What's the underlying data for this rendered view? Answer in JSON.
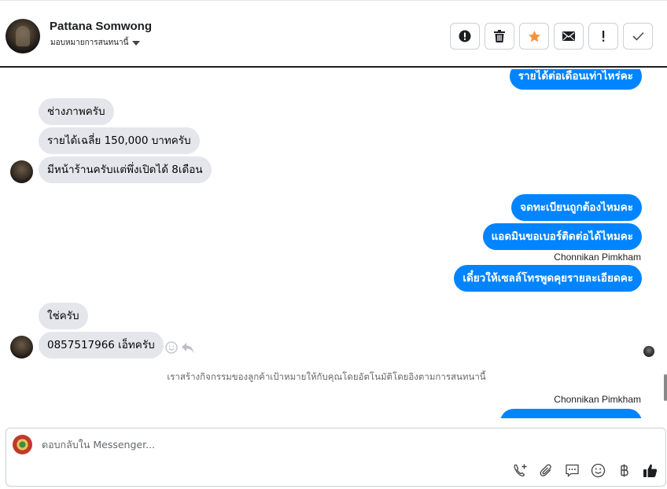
{
  "header": {
    "contact_name": "Pattana Somwong",
    "assign_label": "มอบหมายการสนทนานี้"
  },
  "actions": [
    {
      "name": "report-spam-button",
      "icon": "alert-circle-icon"
    },
    {
      "name": "delete-button",
      "icon": "trash-icon"
    },
    {
      "name": "star-button",
      "icon": "star-icon",
      "color": "#f7923b"
    },
    {
      "name": "mark-unread-button",
      "icon": "envelope-icon"
    },
    {
      "name": "follow-up-button",
      "icon": "exclamation-icon"
    },
    {
      "name": "mark-done-button",
      "icon": "check-icon"
    }
  ],
  "messages": {
    "out_1": "รายได้ต่อเดือนเท่าไหร่คะ",
    "in_1": "ช่างภาพครับ",
    "in_2": "รายได้เฉลี่ย 150,000 บาทครับ",
    "in_3": "มีหน้าร้านครับแต่พึ่งเปิดได้ 8เดือน",
    "out_2": "จดทะเบียนถูกต้องไหมคะ",
    "out_3": "แอดมินขอเบอร์ติดต่อได้ไหมคะ",
    "sender_1": "Chonnikan Pimkham",
    "out_4": "เดี๋ยวให้เซลล์โทรพูดคุยรายละเอียดคะ",
    "in_4": "ใช่ครับ",
    "in_5": "0857517966 เอ็ทครับ",
    "system_note": "เราสร้างกิจกรรมของลูกค้าเป้าหมายให้กับคุณโดยอัตโนมัติโดยอิงตามการสนทนานี้",
    "sender_2": "Chonnikan Pimkham"
  },
  "composer": {
    "placeholder": "ตอบกลับใน Messenger..."
  },
  "colors": {
    "outgoing_bubble": "#0084ff",
    "incoming_bubble": "#e4e6eb",
    "star": "#f7923b"
  }
}
